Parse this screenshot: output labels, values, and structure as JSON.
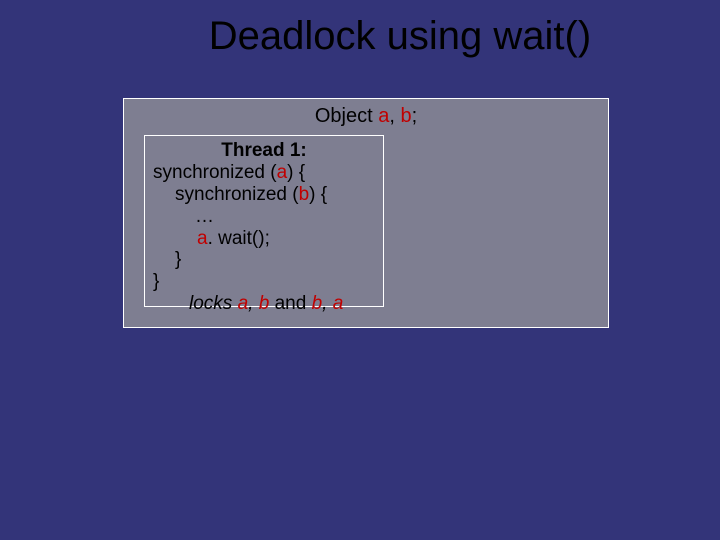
{
  "title": "Deadlock using wait()",
  "object_line": {
    "prefix": "Object ",
    "a": "a",
    "comma1": ", ",
    "b": "b",
    "semicolon": ";"
  },
  "thread": {
    "title": "Thread 1:",
    "line1_pre": "synchronized (",
    "line1_a": "a",
    "line1_post": ") {",
    "line2_pre": "synchronized (",
    "line2_b": "b",
    "line2_post": ") {",
    "line3": "…",
    "line4_a": "a",
    "line4_post": ". wait();",
    "line5": "}",
    "line6": "}",
    "locks_pre": "locks ",
    "locks_a1": "a",
    "locks_c1": ", ",
    "locks_b1": "b",
    "locks_and": " and ",
    "locks_b2": "b",
    "locks_c2": ", ",
    "locks_a2": "a"
  }
}
